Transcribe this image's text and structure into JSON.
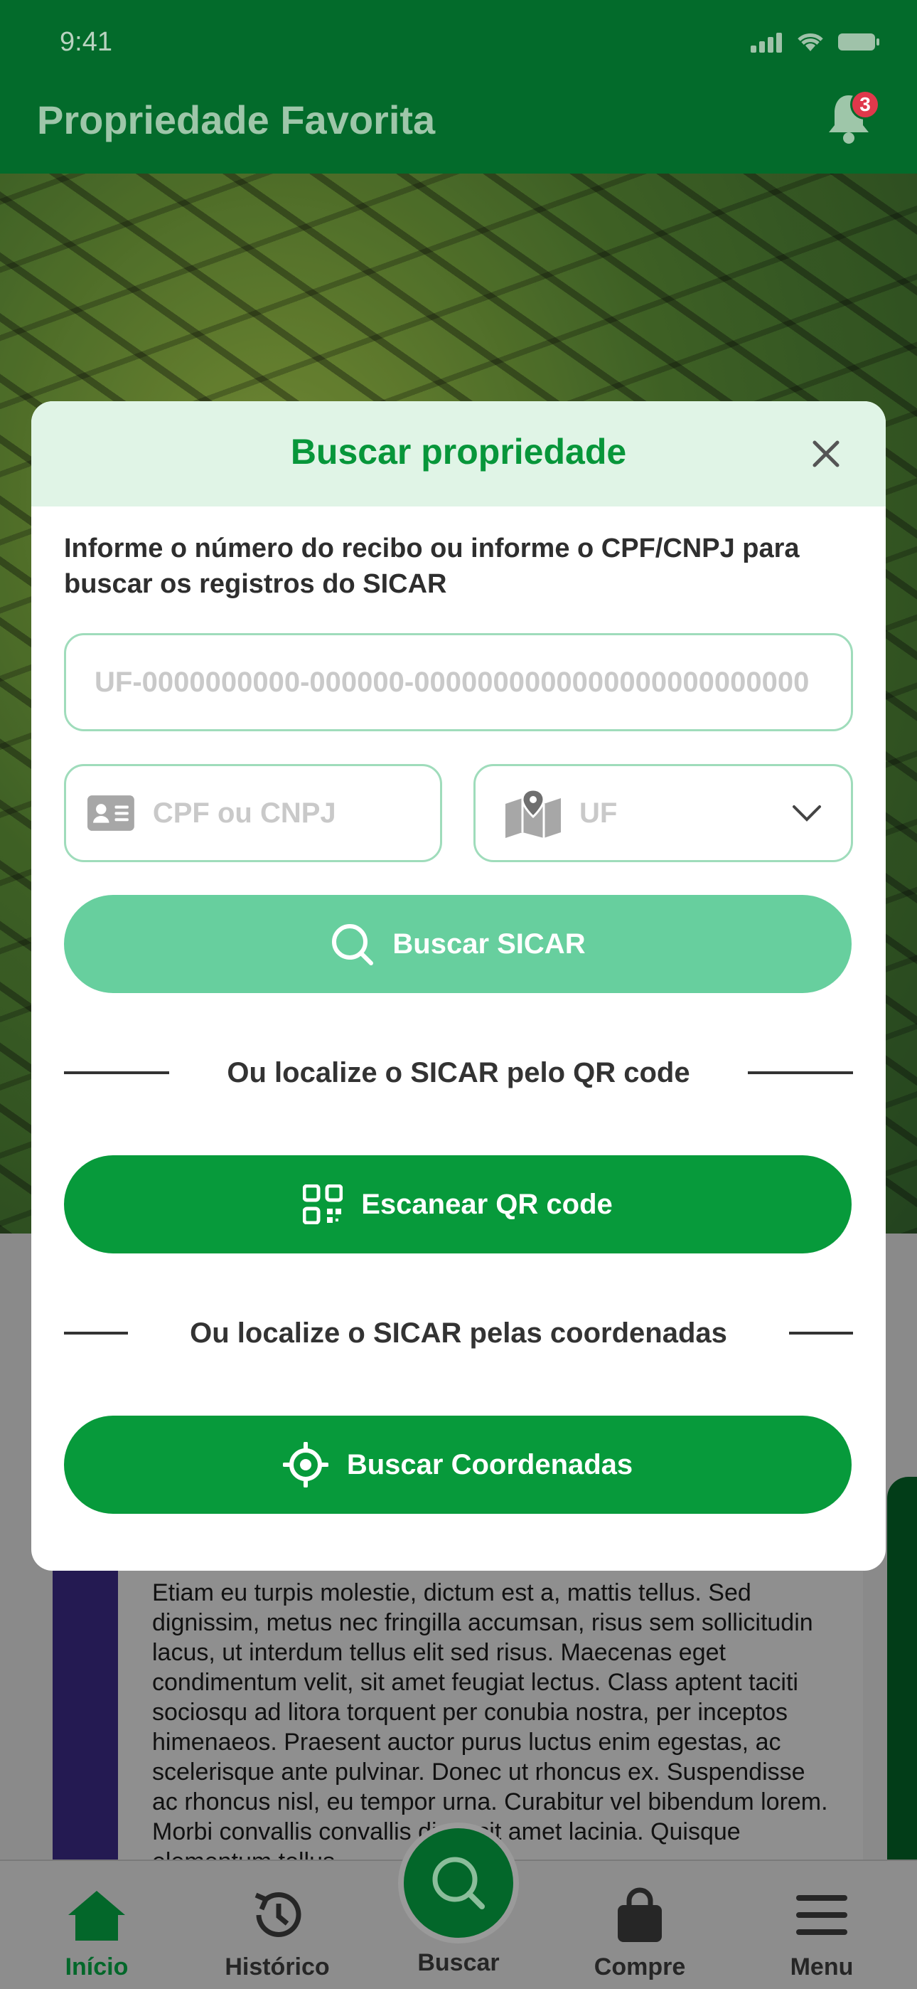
{
  "status_bar": {
    "time": "9:41"
  },
  "header": {
    "title": "Propriedade Favorita",
    "notification_count": "3"
  },
  "background_text": "Etiam eu turpis molestie, dictum est a, mattis tellus. Sed dignissim, metus nec fringilla accumsan, risus sem sollicitudin lacus, ut interdum tellus elit sed risus. Maecenas eget condimentum velit, sit amet feugiat lectus. Class aptent taciti sociosqu ad litora torquent per conubia nostra, per inceptos himenaeos. Praesent auctor purus luctus enim egestas, ac scelerisque ante pulvinar. Donec ut rhoncus ex. Suspendisse ac rhoncus nisl, eu tempor urna. Curabitur vel bibendum lorem. Morbi convallis convallis diam sit amet lacinia. Quisque elementum tellus",
  "modal": {
    "title": "Buscar propriedade",
    "description": "Informe o número do recibo ou informe o CPF/CNPJ para buscar os registros do SICAR",
    "receipt_placeholder": "UF-0000000000-000000-0000000000000000000000000",
    "cpf_placeholder": "CPF ou CNPJ",
    "uf_placeholder": "UF",
    "search_button": "Buscar SICAR",
    "divider_qr": "Ou localize o SICAR pelo QR code",
    "qr_button": "Escanear QR code",
    "divider_coords": "Ou localize o SICAR pelas coordenadas",
    "coords_button": "Buscar Coordenadas"
  },
  "bottom_nav": {
    "items": [
      {
        "label": "Início",
        "icon": "home-icon",
        "active": true
      },
      {
        "label": "Histórico",
        "icon": "history-icon",
        "active": false
      },
      {
        "label": "Buscar",
        "icon": "search-icon",
        "active": false
      },
      {
        "label": "Compre",
        "icon": "bag-icon",
        "active": false
      },
      {
        "label": "Menu",
        "icon": "menu-icon",
        "active": false
      }
    ]
  },
  "colors": {
    "primary": "#079a3b",
    "primary_light": "#67cf9e",
    "header_bg": "#036b2b",
    "modal_header_bg": "#e0f4e6",
    "field_border": "#9fdcbb",
    "badge": "#e0384b"
  }
}
